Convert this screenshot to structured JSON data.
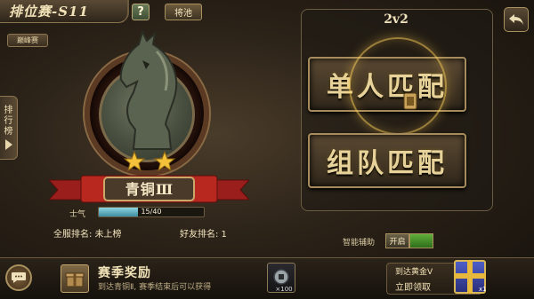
{
  "header": {
    "title": "排位赛-S11",
    "help_label": "?",
    "generals_label": "将池",
    "peak_tag": "巅峰赛"
  },
  "side_tab": {
    "label_line1": "排",
    "label_line2": "行",
    "label_line3": "榜"
  },
  "player": {
    "tier": "青铜Ⅲ",
    "stars": 2,
    "morale_label": "士气",
    "morale_value": "15/40",
    "morale_fraction": 0.375,
    "server_rank": "全服排名: 未上榜",
    "friend_rank": "好友排名: 1"
  },
  "match": {
    "mode": "2v2",
    "solo_label": "单人匹配",
    "team_label": "组队匹配",
    "assist_label": "智能辅助",
    "assist_state": "开启"
  },
  "bottom": {
    "reward_title": "赛季奖励",
    "reward_desc": "到达青铜Ⅱ, 赛季结束后可以获得",
    "coin_count": "×100",
    "gold_line1": "到达黄金V",
    "gold_line2": "立即领取",
    "gift_count": "x1"
  },
  "colors": {
    "gold_text": "#e7d29a",
    "morale_fill": "#5fb3c6",
    "assist_on": "#5fae3a"
  }
}
